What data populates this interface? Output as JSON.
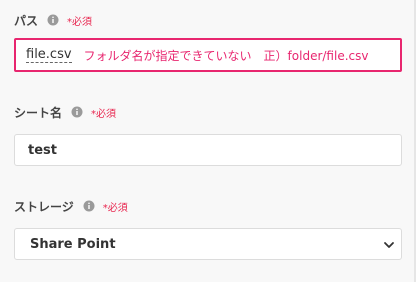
{
  "path_field": {
    "label": "パス",
    "info_icon": "info-icon",
    "required": "*必須",
    "value": "file.csv",
    "annotation": "フォルダ名が指定できていない　正）folder/file.csv",
    "error_color": "#e8266f"
  },
  "sheet_field": {
    "label": "シート名",
    "info_icon": "info-icon",
    "required": "*必須",
    "value": "test"
  },
  "storage_field": {
    "label": "ストレージ",
    "info_icon": "info-icon",
    "required": "*必須",
    "selected": "Share Point",
    "chevron_icon": "chevron-down-icon"
  },
  "colors": {
    "required": "#e8264f",
    "background": "#f8f8f8"
  }
}
